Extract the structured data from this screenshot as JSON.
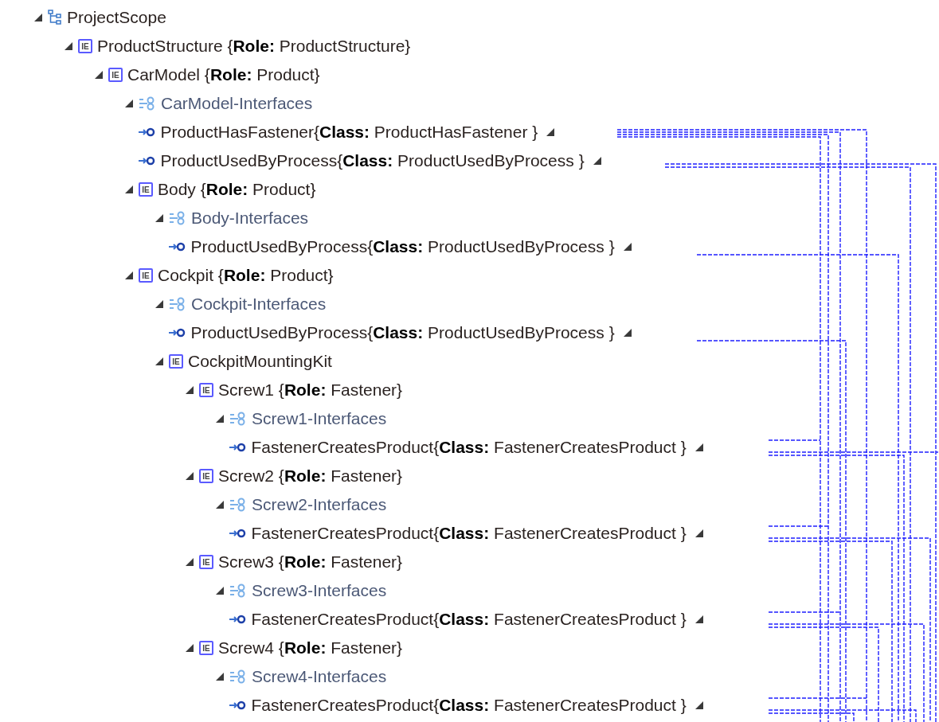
{
  "tree": [
    {
      "kind": "scope",
      "label": "ProjectScope",
      "expanded": true,
      "children": [
        {
          "kind": "element",
          "badge": "IE",
          "label": "ProductStructure {**Role:** ProductStructure}",
          "expanded": true,
          "children": [
            {
              "kind": "element",
              "badge": "IE",
              "label": "CarModel {**Role:** Product}",
              "expanded": true,
              "children": [
                {
                  "kind": "interfaces",
                  "label": "CarModel-Interfaces",
                  "expanded": true,
                  "children": [
                    {
                      "kind": "interface",
                      "label": "ProductHasFastener{**Class:** ProductHasFastener }"
                    },
                    {
                      "kind": "interface",
                      "label": "ProductUsedByProcess{**Class:** ProductUsedByProcess }"
                    }
                  ]
                },
                {
                  "kind": "element",
                  "badge": "IE",
                  "label": "Body {**Role:** Product}",
                  "expanded": true,
                  "children": [
                    {
                      "kind": "interfaces",
                      "label": "Body-Interfaces",
                      "expanded": true,
                      "children": [
                        {
                          "kind": "interface",
                          "label": "ProductUsedByProcess{**Class:** ProductUsedByProcess }"
                        }
                      ]
                    }
                  ]
                },
                {
                  "kind": "element",
                  "badge": "IE",
                  "label": "Cockpit {**Role:** Product}",
                  "expanded": true,
                  "children": [
                    {
                      "kind": "interfaces",
                      "label": "Cockpit-Interfaces",
                      "expanded": true,
                      "children": [
                        {
                          "kind": "interface",
                          "label": "ProductUsedByProcess{**Class:** ProductUsedByProcess }"
                        }
                      ]
                    },
                    {
                      "kind": "element",
                      "badge": "IE",
                      "label": "CockpitMountingKit",
                      "expanded": true,
                      "children": [
                        {
                          "kind": "element",
                          "badge": "IE",
                          "label": "Screw1 {**Role:** Fastener}",
                          "expanded": true,
                          "children": [
                            {
                              "kind": "interfaces",
                              "label": "Screw1-Interfaces",
                              "expanded": true,
                              "children": [
                                {
                                  "kind": "interface",
                                  "label": "FastenerCreatesProduct{**Class:** FastenerCreatesProduct }"
                                }
                              ]
                            }
                          ]
                        },
                        {
                          "kind": "element",
                          "badge": "IE",
                          "label": "Screw2 {**Role:** Fastener}",
                          "expanded": true,
                          "children": [
                            {
                              "kind": "interfaces",
                              "label": "Screw2-Interfaces",
                              "expanded": true,
                              "children": [
                                {
                                  "kind": "interface",
                                  "label": "FastenerCreatesProduct{**Class:** FastenerCreatesProduct }"
                                }
                              ]
                            }
                          ]
                        },
                        {
                          "kind": "element",
                          "badge": "IE",
                          "label": "Screw3 {**Role:** Fastener}",
                          "expanded": true,
                          "children": [
                            {
                              "kind": "interfaces",
                              "label": "Screw3-Interfaces",
                              "expanded": true,
                              "children": [
                                {
                                  "kind": "interface",
                                  "label": "FastenerCreatesProduct{**Class:** FastenerCreatesProduct }"
                                }
                              ]
                            }
                          ]
                        },
                        {
                          "kind": "element",
                          "badge": "IE",
                          "label": "Screw4 {**Role:** Fastener}",
                          "expanded": true,
                          "children": [
                            {
                              "kind": "interfaces",
                              "label": "Screw4-Interfaces",
                              "expanded": true,
                              "children": [
                                {
                                  "kind": "interface",
                                  "label": "FastenerCreatesProduct{**Class:** FastenerCreatesProduct }"
                                }
                              ]
                            }
                          ]
                        }
                      ]
                    }
                  ]
                }
              ]
            }
          ]
        }
      ]
    }
  ]
}
